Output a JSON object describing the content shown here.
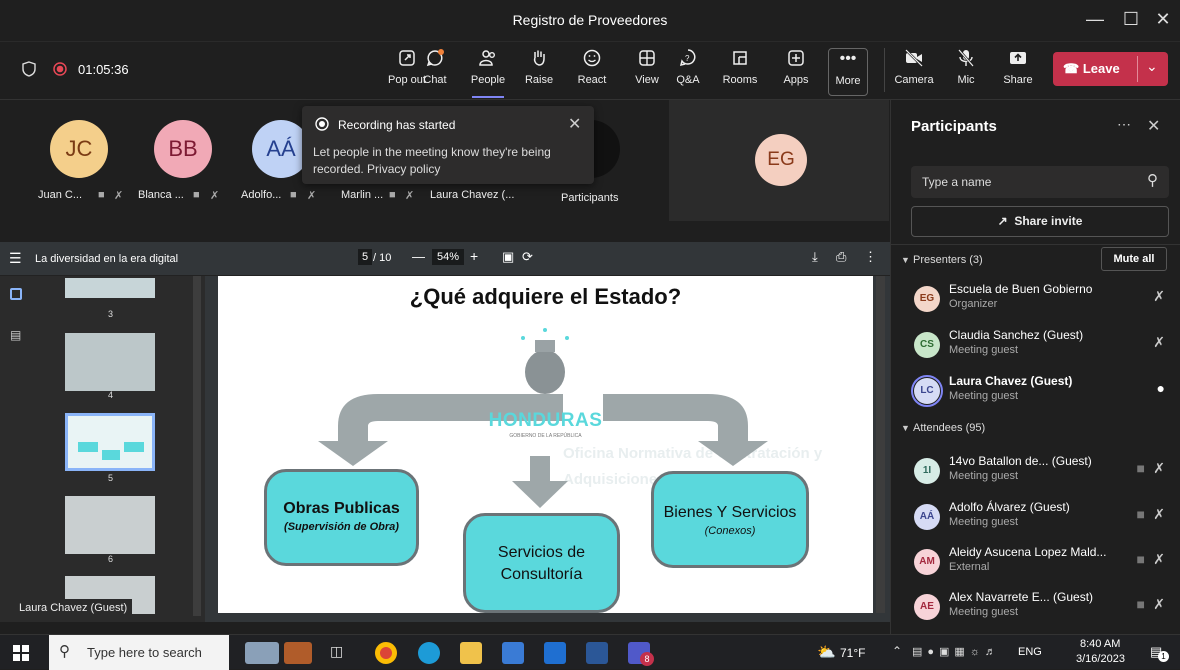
{
  "window": {
    "title": "Registro de Proveedores"
  },
  "toolbar": {
    "timer": "01:05:36",
    "buttons": [
      "Pop out",
      "Chat",
      "People",
      "Raise",
      "React",
      "View",
      "Q&A",
      "Rooms",
      "Apps",
      "More"
    ],
    "camera": "Camera",
    "mic": "Mic",
    "share": "Share",
    "leave": "Leave"
  },
  "strip": {
    "tiles": [
      {
        "initials": "JC",
        "name": "Juan C..."
      },
      {
        "initials": "BB",
        "name": "Blanca ..."
      },
      {
        "initials": "AÁ",
        "name": "Adolfo..."
      },
      {
        "initials": "",
        "name": "Marlin ..."
      },
      {
        "initials": "",
        "name": "Laura Chavez (..."
      }
    ],
    "participants_label": "Participants",
    "featured_initials": "EG"
  },
  "toast": {
    "title": "Recording has started",
    "body": "Let people in the meeting know they're being recorded. Privacy policy"
  },
  "pdf": {
    "title": "La diversidad en la era digital",
    "page": "5",
    "total": "/ 10",
    "zoom": "54%",
    "thumb_pages": [
      "3",
      "4",
      "5",
      "6"
    ],
    "speaker_label": "Laura Chavez (Guest)"
  },
  "slide": {
    "heading": "¿Qué adquiere el Estado?",
    "logo": "HONDURAS",
    "logo_sub": "GOBIERNO DE LA REPÚBLICA",
    "watermark": "Oficina Normativa de Contratación y Adquisiciones del Estado",
    "box1_title": "Obras Publicas",
    "box1_sub": "(Supervisión de Obra)",
    "box2_title": "Servicios de Consultoría",
    "box3_title": "Bienes Y Servicios",
    "box3_sub": "(Conexos)"
  },
  "panel": {
    "title": "Participants",
    "search_placeholder": "Type a name",
    "share_invite": "Share invite",
    "presenters_label": "Presenters (3)",
    "mute_all": "Mute all",
    "attendees_label": "Attendees (95)",
    "presenters": [
      {
        "initials": "EG",
        "name": "Escuela de Buen Gobierno",
        "role": "Organizer",
        "color": "#f3d6c9",
        "fg": "#8a3a1a"
      },
      {
        "initials": "CS",
        "name": "Claudia Sanchez (Guest)",
        "role": "Meeting guest",
        "color": "#c8e6c9",
        "fg": "#2e6b32"
      },
      {
        "initials": "LC",
        "name": "Laura Chavez (Guest)",
        "role": "Meeting guest",
        "color": "#d6dbf5",
        "fg": "#3c468f"
      }
    ],
    "attendees": [
      {
        "initials": "1I",
        "name": "14vo Batallon de... (Guest)",
        "role": "Meeting guest",
        "color": "#d7ece6",
        "fg": "#2f6a5c"
      },
      {
        "initials": "AÁ",
        "name": "Adolfo Álvarez (Guest)",
        "role": "Meeting guest",
        "color": "#d6dbf5",
        "fg": "#3c468f"
      },
      {
        "initials": "AM",
        "name": "Aleidy Asucena Lopez Mald...",
        "role": "External",
        "color": "#f7d3d8",
        "fg": "#a3283e"
      },
      {
        "initials": "AE",
        "name": "Alex Navarrete E... (Guest)",
        "role": "Meeting guest",
        "color": "#f7d3d8",
        "fg": "#a3283e"
      }
    ]
  },
  "taskbar": {
    "search": "Type here to search",
    "temp": "71°F",
    "lang": "ENG",
    "time": "8:40 AM",
    "date": "3/16/2023",
    "teams_badge": "8",
    "notif_badge": "1"
  },
  "colors": {
    "leave": "#c4314b",
    "accent": "#7f85f5",
    "slide_box": "#5ad8dc"
  }
}
